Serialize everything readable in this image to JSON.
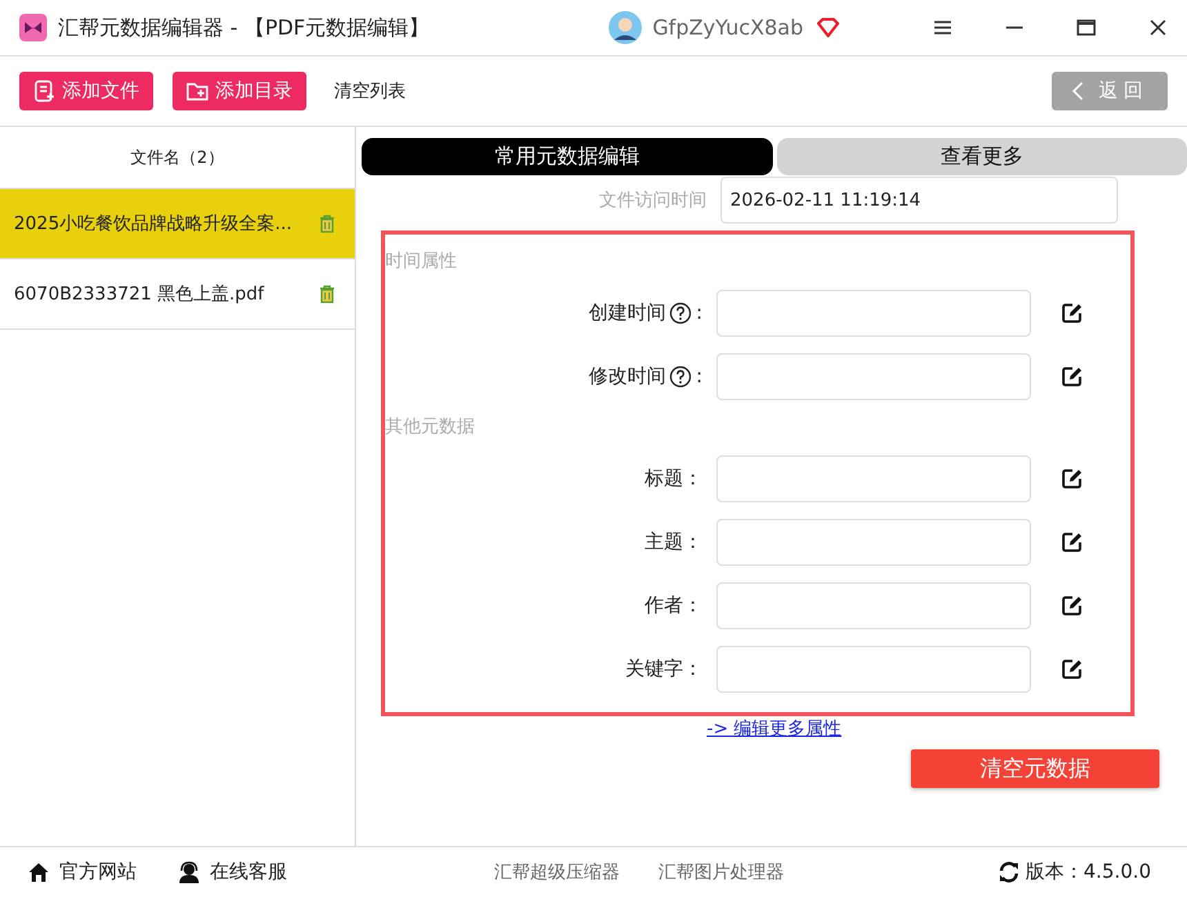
{
  "window": {
    "title": "汇帮元数据编辑器 - 【PDF元数据编辑】",
    "username": "GfpZyYucX8ab"
  },
  "toolbar": {
    "buttons": [
      {
        "label": "添加文件",
        "kind": "file"
      },
      {
        "label": "添加目录",
        "kind": "folder"
      }
    ],
    "clear_list": "清空列表",
    "back": "返回"
  },
  "sidebar": {
    "header": "文件名（2）",
    "files": [
      {
        "name": "2025小吃餐饮品牌战略升级全案...",
        "selected": true
      },
      {
        "name": "6070B2333721 黑色上盖.pdf",
        "selected": false
      }
    ]
  },
  "tabs": [
    {
      "label": "常用元数据编辑",
      "selected": true
    },
    {
      "label": "查看更多",
      "selected": false
    }
  ],
  "access_row": {
    "label": "文件访问时间",
    "value": "2026-02-11 11:19:14"
  },
  "sections": [
    {
      "title": "时间属性",
      "fields": [
        {
          "label": "创建时间",
          "help": true,
          "suffix": ":"
        },
        {
          "label": "修改时间",
          "help": true,
          "suffix": ":"
        }
      ]
    },
    {
      "title": "其他元数据",
      "fields": [
        {
          "label": "标题：",
          "help": false
        },
        {
          "label": "主题：",
          "help": false
        },
        {
          "label": "作者：",
          "help": false
        },
        {
          "label": "关键字：",
          "help": false
        }
      ]
    }
  ],
  "more_link": "-> 编辑更多属性",
  "clear_button": "清空元数据",
  "footer": {
    "links": [
      {
        "label": "官方网站",
        "kind": "home"
      },
      {
        "label": "在线客服",
        "kind": "support"
      }
    ],
    "products": [
      "汇帮超级压缩器",
      "汇帮图片处理器"
    ],
    "version": "版本：4.5.0.0"
  }
}
